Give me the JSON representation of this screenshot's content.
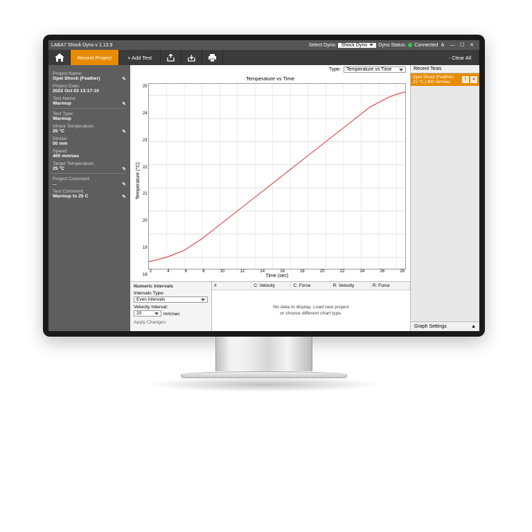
{
  "titlebar": {
    "title": "LABA7 Shock Dyno  v 1.13.9",
    "select_dyno_label": "Select Dyno:",
    "select_dyno_value": "Shock Dyno",
    "dyno_status_label": "Dyno Status:",
    "dyno_status_value": "Connected"
  },
  "toolbar": {
    "recent_project": "Recent Project",
    "add_test": "+ Add Test",
    "clear_all": "- Clear All"
  },
  "sidebar": {
    "project_name_label": "Project Name:",
    "project_name": "Opel Shock (Feather)",
    "project_date_label": "Project Date:",
    "project_date": "2022 Oct 03 13:17:10",
    "test_name_label": "Test Name:",
    "test_name": "Warmup",
    "test_type_label": "Test Type:",
    "test_type": "Warmup",
    "shock_temp_label": "Shock Temperature:",
    "shock_temp": "25 °C",
    "stroke_label": "Stroke:",
    "stroke": "50 mm",
    "speed_label": "Speed:",
    "speed": "400 mm/sec",
    "target_temp_label": "Target Temperature:",
    "target_temp": "25 °C",
    "project_comment_label": "Project Comment:",
    "project_comment": "...",
    "test_comment_label": "Test Comment:",
    "test_comment": "Warmup to 25 C"
  },
  "chart_area": {
    "type_label": "Type:",
    "type_value": "Temperature vs Time"
  },
  "numeric_intervals": {
    "header": "Numeric Intervals",
    "intervals_type_label": "Intervals Type:",
    "intervals_type": "Even Intervals",
    "velocity_interval_label": "Velocity Interval:",
    "velocity_interval": "20",
    "velocity_unit": "mm/sec",
    "apply_changes": "Apply Changes"
  },
  "data_table": {
    "cols": {
      "c0": "#",
      "c1": "C: Velocity",
      "c2": "C: Force",
      "c3": "R: Velocity",
      "c4": "R: Force"
    },
    "empty1": "No data to display. Load new project",
    "empty2": "or choose different chart type."
  },
  "right": {
    "recent_tests": "Recent Tests",
    "item_line1": "Opel Shock (Feather)",
    "item_line2": "25 °C | 400 mm/sec",
    "graph_settings": "Graph Settings"
  },
  "chart_data": {
    "type": "line",
    "title": "Temperature vs Time",
    "xlabel": "Time (sec)",
    "ylabel": "Temperature (°C)",
    "xlim": [
      0,
      29
    ],
    "ylim": [
      17.5,
      25.5
    ],
    "xticks": [
      2,
      4,
      6,
      8,
      10,
      12,
      14,
      16,
      18,
      20,
      22,
      24,
      26,
      28
    ],
    "yticks": [
      18,
      19,
      20,
      21,
      22,
      23,
      24,
      25
    ],
    "x": [
      0,
      1,
      2,
      3,
      4,
      5,
      6,
      7,
      8,
      9,
      10,
      11,
      12,
      13,
      14,
      15,
      16,
      17,
      18,
      19,
      20,
      21,
      22,
      23,
      24,
      25,
      26,
      27,
      28,
      29
    ],
    "y": [
      17.8,
      17.9,
      18.0,
      18.15,
      18.3,
      18.55,
      18.8,
      19.1,
      19.4,
      19.7,
      20.0,
      20.3,
      20.6,
      20.9,
      21.2,
      21.5,
      21.8,
      22.1,
      22.4,
      22.7,
      23.0,
      23.3,
      23.6,
      23.9,
      24.2,
      24.5,
      24.7,
      24.9,
      25.05,
      25.15
    ]
  }
}
